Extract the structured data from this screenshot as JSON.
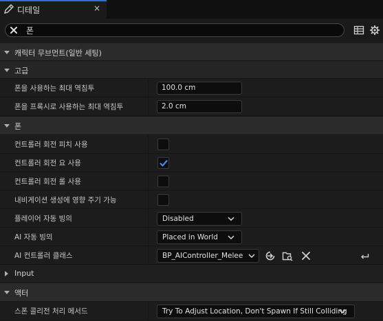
{
  "tab": {
    "label": "디테일",
    "icon": "details-pencil-icon",
    "close": "×"
  },
  "search": {
    "value": "폰",
    "placeholder": ""
  },
  "toolbar": {
    "icons": [
      "table-view-icon",
      "settings-gear-icon"
    ]
  },
  "sections": {
    "character_movement": "캐릭터 무브먼트(일반 세팅)",
    "advanced": "고급",
    "pawn": "폰",
    "input": "Input",
    "actor": "액터"
  },
  "rows": {
    "max_depenetration": {
      "label": "폰을 사용하는 최대 역침투",
      "value": "100.0 cm"
    },
    "max_depenetration_proxy": {
      "label": "폰을 프록시로 사용하는 최대 역침투",
      "value": "2.0 cm"
    },
    "use_controller_pitch": {
      "label": "컨트롤러 회전 피치 사용",
      "checked": false
    },
    "use_controller_yaw": {
      "label": "컨트롤러 회전 요 사용",
      "checked": true
    },
    "use_controller_roll": {
      "label": "컨트롤러 회전 롤 사용",
      "checked": false
    },
    "nav_affect": {
      "label": "내비게이션 생성에 영향 주기 가능",
      "checked": false
    },
    "auto_possess_player": {
      "label": "플레이어 자동 빙의",
      "value": "Disabled"
    },
    "auto_possess_ai": {
      "label": "AI 자동 빙의",
      "value": "Placed in World"
    },
    "ai_controller_class": {
      "label": "AI 컨트롤러 클래스",
      "value": "BP_AIController_Melee"
    },
    "spawn_collision": {
      "label": "스폰 콜리전 처리 메서드",
      "value": "Try To Adjust Location, Don't Spawn If Still Colliding"
    }
  },
  "colors": {
    "accent": "#2f6fd9",
    "check": "#3d8ef0",
    "panel": "#1c1c1c",
    "section": "#2b2b2b"
  }
}
